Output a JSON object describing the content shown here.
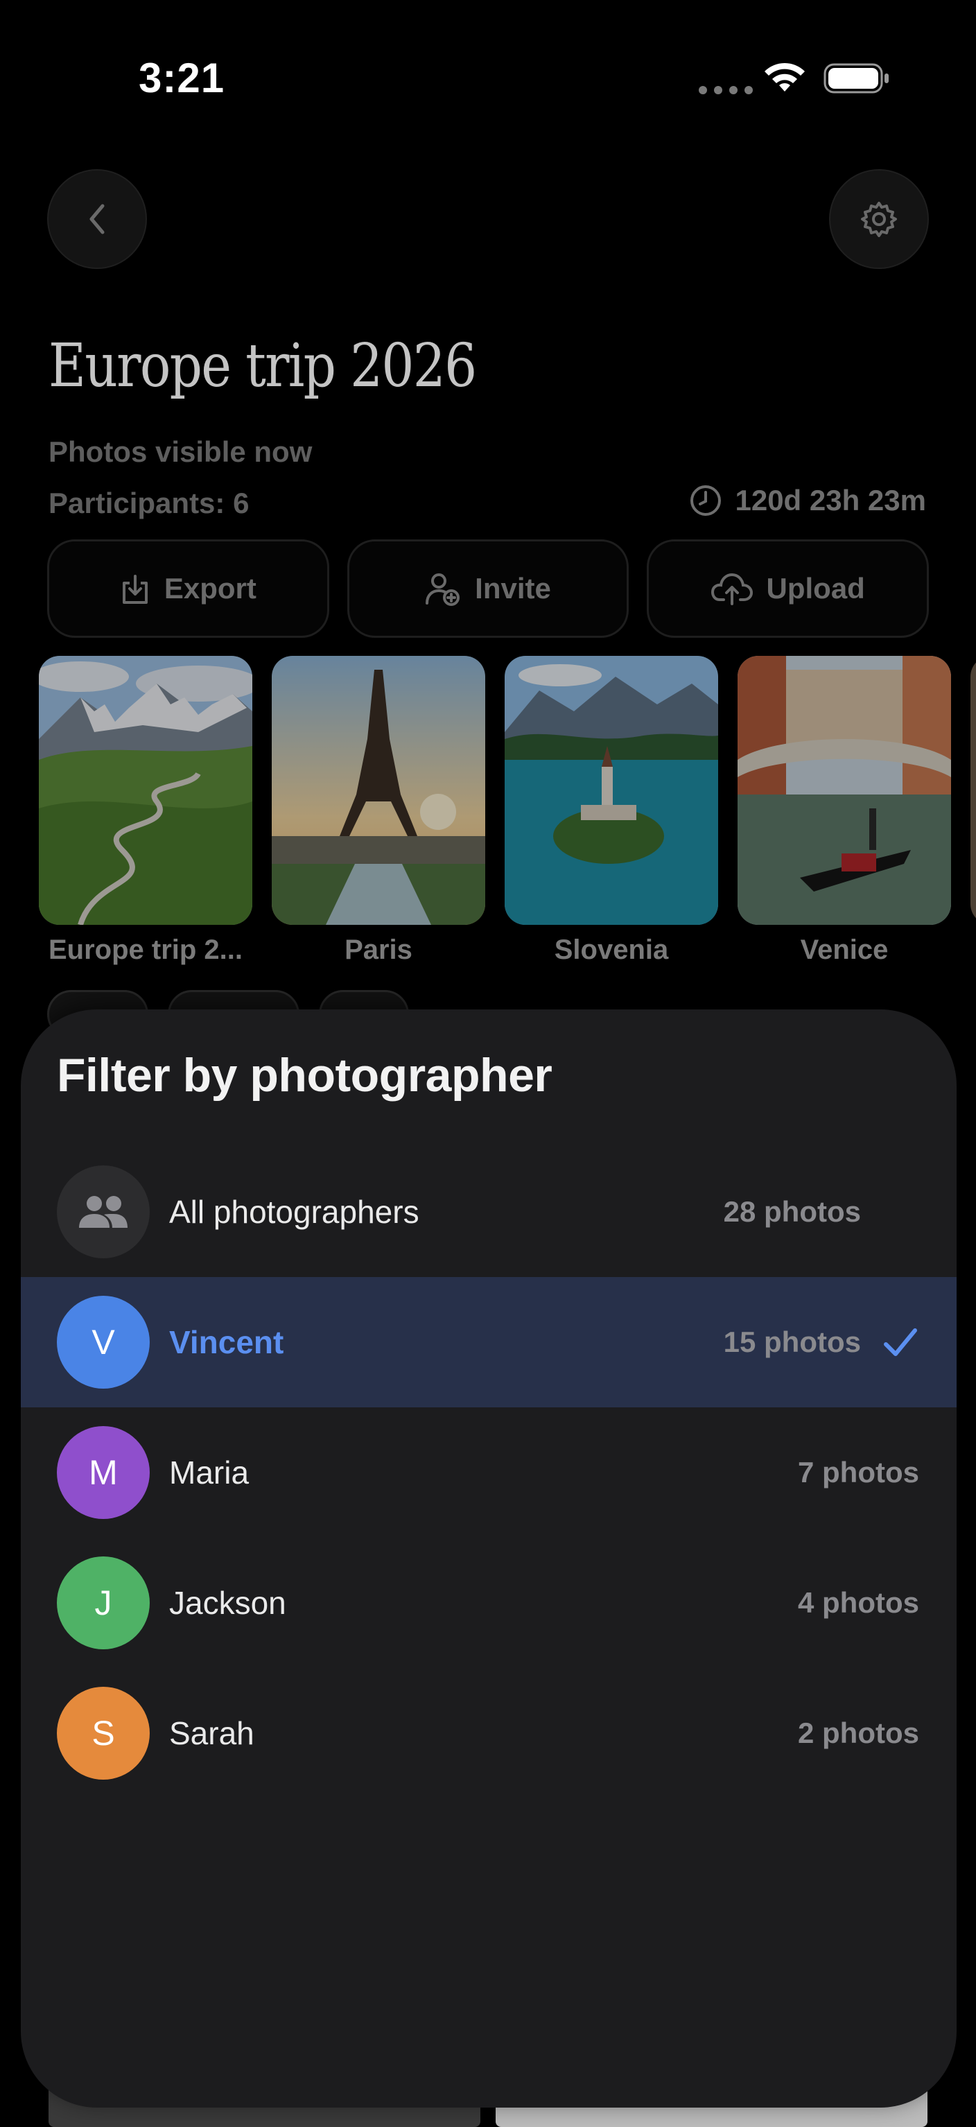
{
  "status_bar": {
    "time": "3:21"
  },
  "header": {
    "title": "Europe trip 2026"
  },
  "info": {
    "visibility": "Photos visible now",
    "participants": "Participants: 6",
    "countdown": "120d 23h 23m"
  },
  "actions": {
    "export_label": "Export",
    "invite_label": "Invite",
    "upload_label": "Upload"
  },
  "albums": [
    {
      "label": "Europe trip 2..."
    },
    {
      "label": "Paris"
    },
    {
      "label": "Slovenia"
    },
    {
      "label": "Venice"
    }
  ],
  "sheet": {
    "title": "Filter by photographer",
    "rows": [
      {
        "name": "All photographers",
        "count": "28 photos",
        "initial": "",
        "color": "#2c2c2e",
        "selected": false
      },
      {
        "name": "Vincent",
        "count": "15 photos",
        "initial": "V",
        "color": "#4a84e6",
        "selected": true
      },
      {
        "name": "Maria",
        "count": "7 photos",
        "initial": "M",
        "color": "#8f4fcc",
        "selected": false
      },
      {
        "name": "Jackson",
        "count": "4 photos",
        "initial": "J",
        "color": "#4fb266",
        "selected": false
      },
      {
        "name": "Sarah",
        "count": "2 photos",
        "initial": "S",
        "color": "#e58a3c",
        "selected": false
      }
    ]
  },
  "colors": {
    "accent": "#5b8ff0",
    "sheet_bg": "#1c1c1e",
    "selected_row": "#27304a"
  }
}
